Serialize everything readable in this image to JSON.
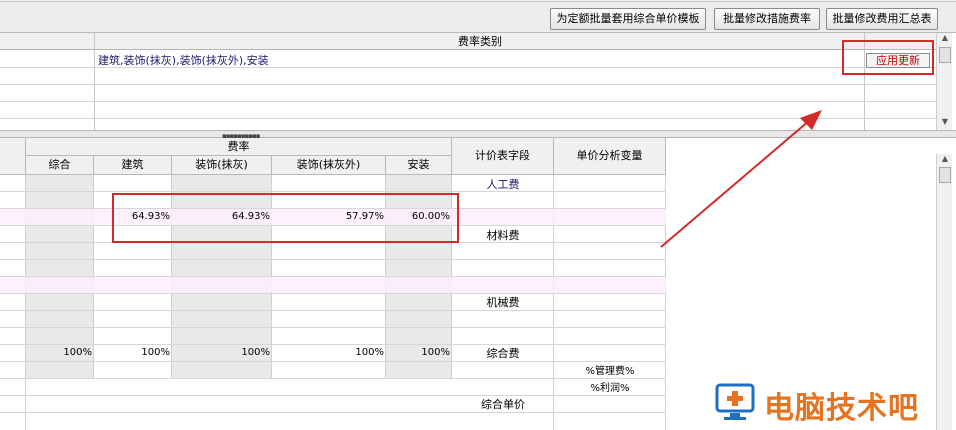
{
  "toolbar": {
    "buttons": [
      "为定额批量套用综合单价模板",
      "批量修改措施费率",
      "批量修改费用汇总表"
    ]
  },
  "upper_grid": {
    "header": "费率类别",
    "row1_text": "建筑,装饰(抹灰),装饰(抹灰外),安装",
    "apply_button": "应用更新"
  },
  "lower_grid": {
    "group_header": "费率",
    "columns": [
      "综合",
      "建筑",
      "装饰(抹灰)",
      "装饰(抹灰外)",
      "安装"
    ],
    "field_header": "计价表字段",
    "var_header": "单价分析变量",
    "rate_row": [
      "",
      "64.93%",
      "64.93%",
      "57.97%",
      "60.00%"
    ],
    "total_row": [
      "100%",
      "100%",
      "100%",
      "100%",
      "100%"
    ],
    "fields": {
      "labor": "人工费",
      "material": "材料费",
      "machine": "机械费",
      "comprehensive": "综合费",
      "unit_price": "综合单价"
    },
    "variables": {
      "mgmt": "%管理费%",
      "profit": "%利润%"
    }
  },
  "watermark": {
    "text": "电脑技术吧",
    "icon": "monitor-plus-icon"
  },
  "colors": {
    "highlight_red": "#d42a2a",
    "apply_text": "#c00000",
    "watermark_orange": "#e5731f",
    "watermark_blue": "#1e6fc3"
  }
}
